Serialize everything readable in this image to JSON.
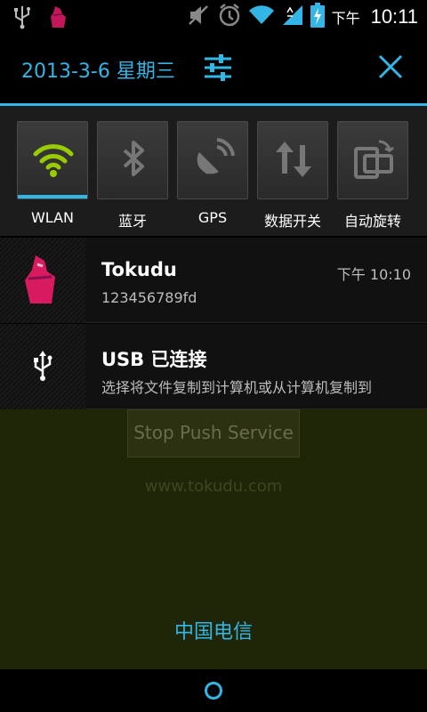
{
  "status_bar": {
    "ampm": "下午",
    "time": "10:11",
    "icons": [
      "usb-icon",
      "tokudu-app-icon",
      "mute-icon",
      "alarm-icon",
      "wifi-icon",
      "mobile-signal-icon",
      "battery-charging-icon"
    ]
  },
  "header": {
    "date": "2013-3-6 星期三",
    "settings_icon": "settings-sliders-icon",
    "close_icon": "close-icon"
  },
  "quick_toggles": [
    {
      "label": "WLAN",
      "icon": "wifi-icon",
      "active": true
    },
    {
      "label": "蓝牙",
      "icon": "bluetooth-icon",
      "active": false
    },
    {
      "label": "GPS",
      "icon": "gps-icon",
      "active": false
    },
    {
      "label": "数据开关",
      "icon": "data-arrows-icon",
      "active": false
    },
    {
      "label": "自动旋转",
      "icon": "rotate-icon",
      "active": false
    }
  ],
  "notifications": [
    {
      "title": "Tokudu",
      "text": "123456789fd",
      "time": "下午 10:10",
      "icon": "tokudu-app-icon"
    },
    {
      "title": "USB 已连接",
      "text": "选择将文件复制到计算机或从计算机复制到",
      "icon": "usb-icon"
    }
  ],
  "app": {
    "button_label": "Stop Push Service",
    "website": "www.tokudu.com",
    "carrier": "中国电信"
  },
  "colors": {
    "accent": "#33b5e5",
    "wifi_active": "#99cc00",
    "app_background": "#1f2607"
  }
}
